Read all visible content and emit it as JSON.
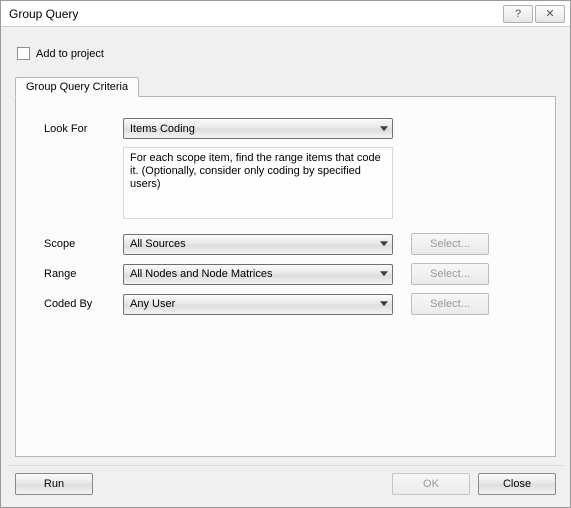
{
  "title": "Group Query",
  "titlebar": {
    "help": "?",
    "close": "✕"
  },
  "addToProject": {
    "label": "Add to project",
    "checked": false
  },
  "tab": {
    "label": "Group Query Criteria"
  },
  "labels": {
    "lookFor": "Look For",
    "scope": "Scope",
    "range": "Range",
    "codedBy": "Coded By"
  },
  "combos": {
    "lookFor": "Items Coding",
    "scope": "All Sources",
    "range": "All Nodes and Node Matrices",
    "codedBy": "Any User"
  },
  "description": "For each scope item, find the range items that code it. (Optionally, consider only coding by specified users)",
  "selectLabel": "Select...",
  "footer": {
    "run": "Run",
    "ok": "OK",
    "close": "Close"
  }
}
